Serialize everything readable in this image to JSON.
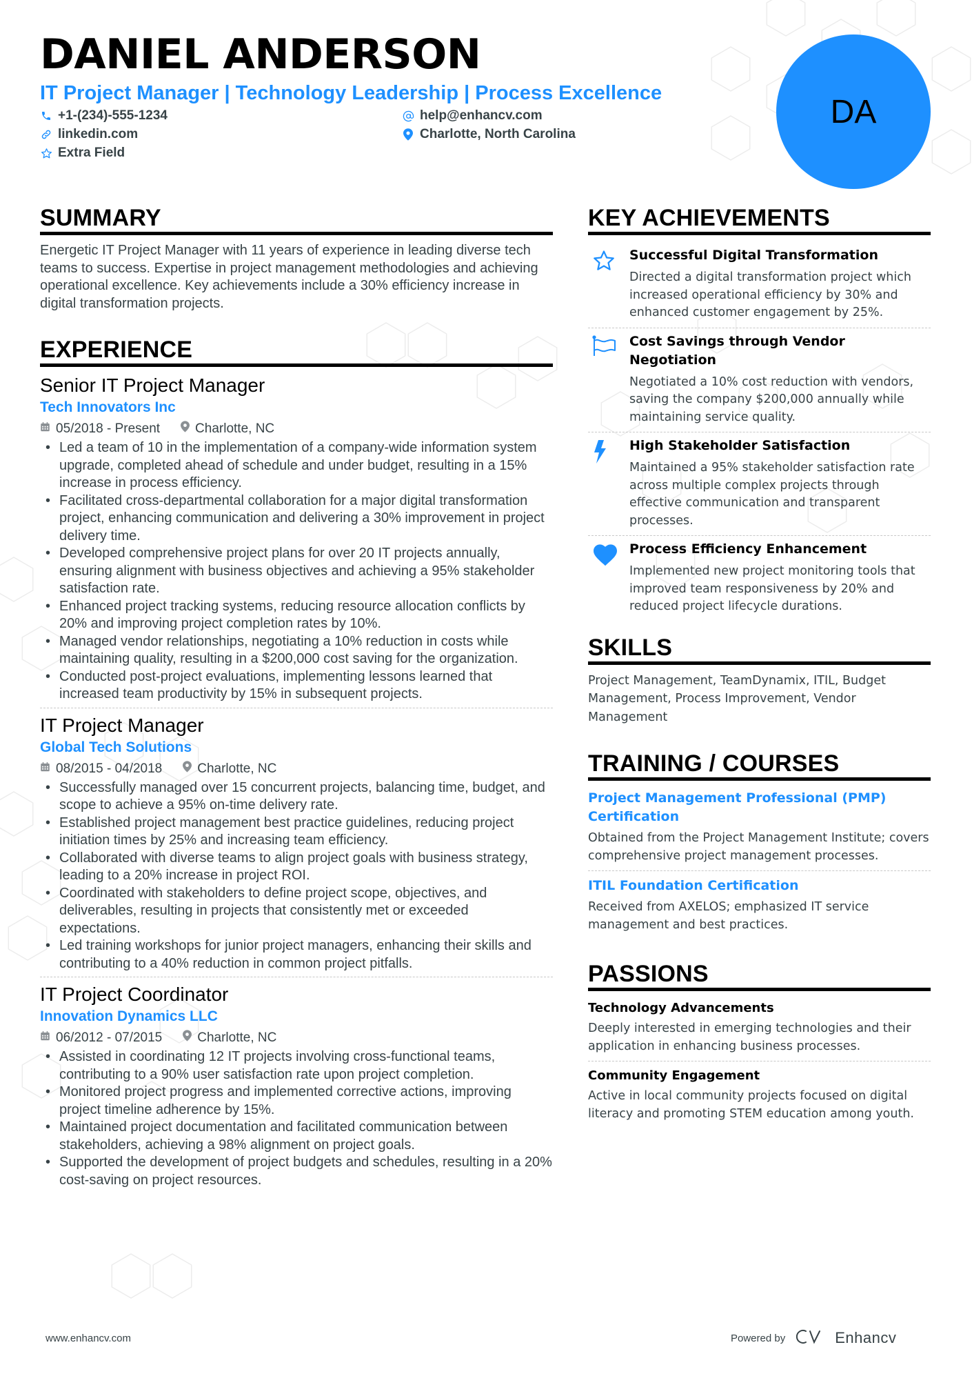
{
  "header": {
    "name": "DANIEL ANDERSON",
    "headline": "IT Project Manager | Technology Leadership | Process Excellence",
    "initials": "DA",
    "contacts": {
      "phone": {
        "icon": "phone-icon",
        "text": "+1-(234)-555-1234"
      },
      "email": {
        "icon": "at-icon",
        "text": "help@enhancv.com"
      },
      "linkedin": {
        "icon": "link-icon",
        "text": "linkedin.com"
      },
      "location": {
        "icon": "map-pin-icon",
        "text": "Charlotte, North Carolina"
      },
      "extra": {
        "icon": "star-icon",
        "text": "Extra Field"
      }
    }
  },
  "colors": {
    "accent": "#1E90FF",
    "text": "#384347",
    "heading": "#000000"
  },
  "summary": {
    "title": "SUMMARY",
    "text": "Energetic IT Project Manager with 11 years of experience in leading diverse tech teams to success. Expertise in project management methodologies and achieving operational excellence. Key achievements include a 30% efficiency increase in digital transformation projects."
  },
  "experience": {
    "title": "EXPERIENCE",
    "jobs": [
      {
        "title": "Senior IT Project Manager",
        "company": "Tech Innovators Inc",
        "dates": "05/2018 - Present",
        "location": "Charlotte, NC",
        "bullets": [
          "Led a team of 10 in the implementation of a company-wide information system upgrade, completed ahead of schedule and under budget, resulting in a 15% increase in process efficiency.",
          "Facilitated cross-departmental collaboration for a major digital transformation project, enhancing communication and delivering a 30% improvement in project delivery time.",
          "Developed comprehensive project plans for over 20 IT projects annually, ensuring alignment with business objectives and achieving a 95% stakeholder satisfaction rate.",
          "Enhanced project tracking systems, reducing resource allocation conflicts by 20% and improving project completion rates by 10%.",
          "Managed vendor relationships, negotiating a 10% reduction in costs while maintaining quality, resulting in a $200,000 cost saving for the organization.",
          "Conducted post-project evaluations, implementing lessons learned that increased team productivity by 15% in subsequent projects."
        ]
      },
      {
        "title": "IT Project Manager",
        "company": "Global Tech Solutions",
        "dates": "08/2015 - 04/2018",
        "location": "Charlotte, NC",
        "bullets": [
          "Successfully managed over 15 concurrent projects, balancing time, budget, and scope to achieve a 95% on-time delivery rate.",
          "Established project management best practice guidelines, reducing project initiation times by 25% and increasing team efficiency.",
          "Collaborated with diverse teams to align project goals with business strategy, leading to a 20% increase in project ROI.",
          "Coordinated with stakeholders to define project scope, objectives, and deliverables, resulting in projects that consistently met or exceeded expectations.",
          "Led training workshops for junior project managers, enhancing their skills and contributing to a 40% reduction in common project pitfalls."
        ]
      },
      {
        "title": "IT Project Coordinator",
        "company": "Innovation Dynamics LLC",
        "dates": "06/2012 - 07/2015",
        "location": "Charlotte, NC",
        "bullets": [
          "Assisted in coordinating 12 IT projects involving cross-functional teams, contributing to a 90% user satisfaction rate upon project completion.",
          "Monitored project progress and implemented corrective actions, improving project timeline adherence by 15%.",
          "Maintained project documentation and facilitated communication between stakeholders, achieving a 98% alignment on project goals.",
          "Supported the development of project budgets and schedules, resulting in a 20% cost-saving on project resources."
        ]
      }
    ]
  },
  "achievements": {
    "title": "KEY ACHIEVEMENTS",
    "items": [
      {
        "icon": "star-icon",
        "title": "Successful Digital Transformation",
        "description": "Directed a digital transformation project which increased operational efficiency by 30% and enhanced customer engagement by 25%."
      },
      {
        "icon": "flag-icon",
        "title": "Cost Savings through Vendor Negotiation",
        "description": "Negotiated a 10% cost reduction with vendors, saving the company $200,000 annually while maintaining service quality."
      },
      {
        "icon": "lightning-bolt-icon",
        "title": "High Stakeholder Satisfaction",
        "description": "Maintained a 95% stakeholder satisfaction rate across multiple complex projects through effective communication and transparent processes."
      },
      {
        "icon": "heart-icon",
        "title": "Process Efficiency Enhancement",
        "description": "Implemented new project monitoring tools that improved team responsiveness by 20% and reduced project lifecycle durations."
      }
    ]
  },
  "skills": {
    "title": "SKILLS",
    "text": "Project Management, TeamDynamix, ITIL, Budget Management, Process Improvement, Vendor Management"
  },
  "training": {
    "title": "TRAINING / COURSES",
    "items": [
      {
        "title": "Project Management Professional (PMP) Certification",
        "description": "Obtained from the Project Management Institute; covers comprehensive project management processes."
      },
      {
        "title": "ITIL Foundation Certification",
        "description": "Received from AXELOS; emphasized IT service management and best practices."
      }
    ]
  },
  "passions": {
    "title": "PASSIONS",
    "items": [
      {
        "title": "Technology Advancements",
        "description": "Deeply interested in emerging technologies and their application in enhancing business processes."
      },
      {
        "title": "Community Engagement",
        "description": "Active in local community projects focused on digital literacy and promoting STEM education among youth."
      }
    ]
  },
  "footer": {
    "website": "www.enhancv.com",
    "powered_by": "Powered by",
    "brand": "Enhancv"
  }
}
